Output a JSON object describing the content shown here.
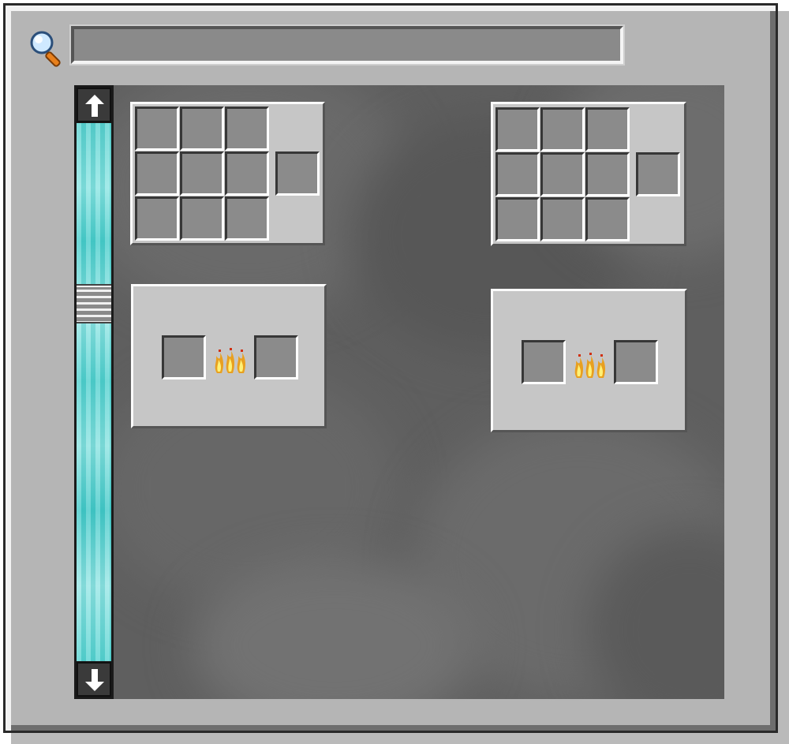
{
  "search": {
    "value": "",
    "placeholder": ""
  },
  "scrollbar": {
    "position": 0.32
  },
  "recipes": [
    {
      "type": "crafting-grid",
      "grid_slots": 9,
      "output_slots": 1
    },
    {
      "type": "crafting-grid",
      "grid_slots": 9,
      "output_slots": 1
    },
    {
      "type": "smelting",
      "input_slots": 1,
      "output_slots": 1
    },
    {
      "type": "smelting",
      "input_slots": 1,
      "output_slots": 1
    }
  ],
  "colors": {
    "accent_scroll": "#5fd3d1",
    "panel": "#c6c6c6",
    "slot": "#8b8b8b",
    "background": "#5f5f5f"
  },
  "icons": {
    "search": "magnifier-icon",
    "up": "arrow-up-icon",
    "down": "arrow-down-icon",
    "fire": "flame-icon"
  }
}
